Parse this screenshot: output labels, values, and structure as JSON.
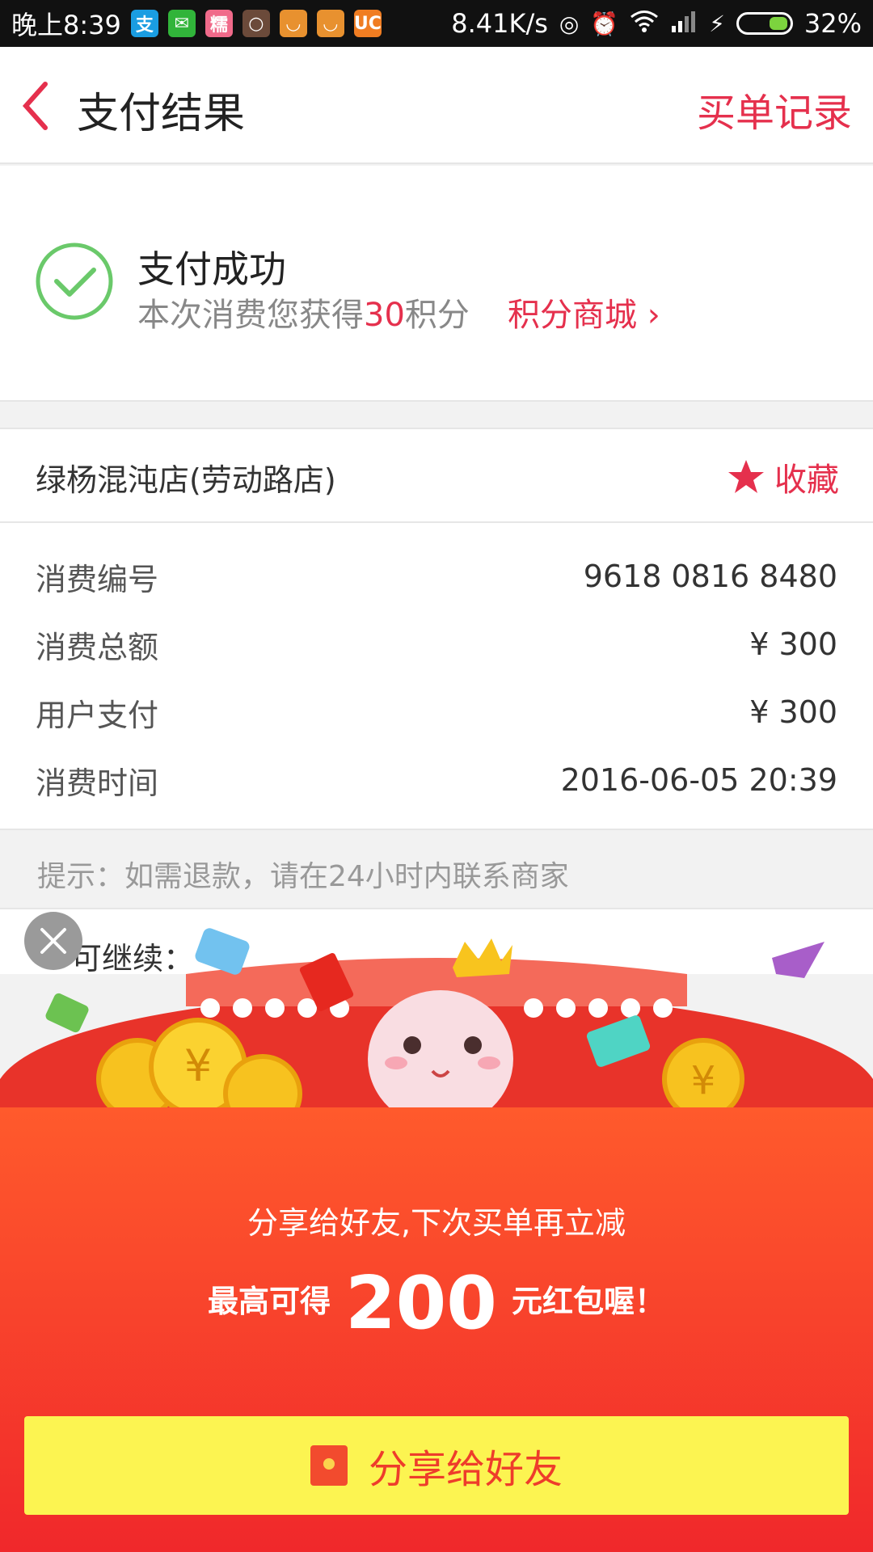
{
  "status_bar": {
    "time": "晚上8:39",
    "speed": "8.41K/s",
    "battery": "32%",
    "apps": [
      {
        "name": "alipay-icon",
        "glyph": "支",
        "color": "#1a9de2"
      },
      {
        "name": "wechat-icon",
        "glyph": "✉",
        "color": "#31b43a"
      },
      {
        "name": "app-icon",
        "glyph": "糯",
        "color": "#f06a8a"
      },
      {
        "name": "app-icon",
        "glyph": "○",
        "color": "#6b4a3a"
      },
      {
        "name": "shopping-icon",
        "glyph": "◡",
        "color": "#e8912f"
      },
      {
        "name": "shopping-icon",
        "glyph": "◡",
        "color": "#e8912f"
      },
      {
        "name": "uc-browser-icon",
        "glyph": "UC",
        "color": "#f07d22"
      }
    ]
  },
  "header": {
    "title": "支付结果",
    "record_link": "买单记录"
  },
  "success": {
    "title": "支付成功",
    "desc_prefix": "本次消费您获得",
    "points": "30",
    "desc_suffix": "积分",
    "mall_link": "积分商城"
  },
  "store": {
    "name": "绿杨混沌店(劳动路店)",
    "fav_label": "收藏"
  },
  "details": [
    {
      "label": "消费编号",
      "value": "9618 0816 8480"
    },
    {
      "label": "消费总额",
      "value": "¥ 300"
    },
    {
      "label": "用户支付",
      "value": "¥ 300"
    },
    {
      "label": "消费时间",
      "value": "2016-06-05 20:39"
    }
  ],
  "tip": "提示：如需退款，请在24小时内联系商家",
  "continue_text": "可继续：",
  "promo": {
    "line1": "分享给好友,下次买单再立减",
    "line2_prefix": "最高可得",
    "amount": "200",
    "line2_suffix": "元红包喔！",
    "share_button": "分享给好友"
  },
  "colors": {
    "accent": "#e5304d",
    "success_green": "#6ac96a",
    "promo_red": "#f0282b",
    "share_yellow": "#fcf451"
  }
}
